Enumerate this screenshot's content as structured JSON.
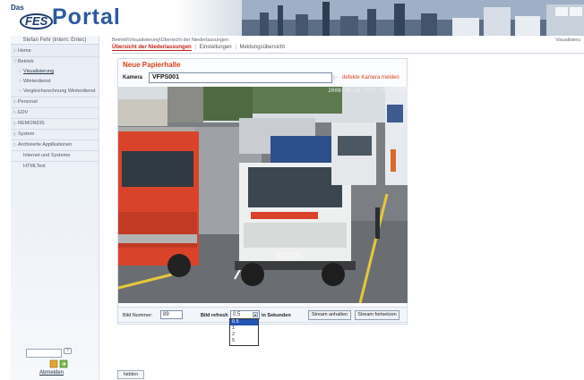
{
  "header": {
    "logo_das": "Das",
    "logo_fes": "FES",
    "logo_portal": "Portal"
  },
  "sidebar": {
    "user": "Stefan Fehr (Intern: Entec)",
    "items": [
      {
        "label": "Home"
      },
      {
        "label": "Betrieb"
      },
      {
        "label": "Visualisierung"
      },
      {
        "label": "Winterdienst"
      },
      {
        "label": "Vergleichsrechnung Winterdienst"
      },
      {
        "label": "Personal"
      },
      {
        "label": "EDV"
      },
      {
        "label": "REMONDIS"
      },
      {
        "label": "System"
      },
      {
        "label": "Archivierte Applikationen"
      },
      {
        "label": "Internet und Systeme"
      },
      {
        "label": "HTMLText"
      }
    ],
    "logout_label": "Abmelden",
    "help_glyph": "?"
  },
  "breadcrumb": "Betrieb\\Visualisierung\\Übersicht der Niederlassungen",
  "top_right": "Visualisieru",
  "tabs": [
    {
      "label": "Übersicht der Niederlassungen"
    },
    {
      "label": "Einstellungen"
    },
    {
      "label": "Meldungsübersicht"
    }
  ],
  "panel": {
    "title": "Neue Papierhalle",
    "kamera_label": "Kamera",
    "kamera_value": "VFPS001",
    "defekt_link": "defekte Kamera melden",
    "camera_timestamp": "2008-09-16 CEST 10:48:00"
  },
  "controls": {
    "bild_label": "Bild Nummer:",
    "bild_value": "89",
    "refresh_label": "Bild refresh",
    "refresh_value": "0.5",
    "sekunden_label": "in Sekunden",
    "stop_button": "Stream anhalten",
    "continue_button": "Stream fortsetzen",
    "options": [
      "0.5",
      "1",
      "2",
      "5"
    ]
  },
  "hidden_button": "hidden",
  "colors": {
    "accent": "#c8211a",
    "title_orange": "#d5431c",
    "sidebar_bg": "#e8edf5",
    "dropdown_selected": "#2353b5"
  }
}
